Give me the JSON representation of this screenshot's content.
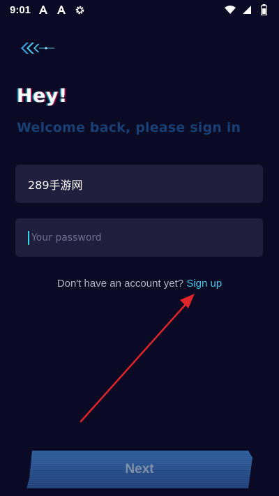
{
  "status_bar": {
    "time": "9:01",
    "icons": [
      "font-a-icon",
      "font-a-icon",
      "settings-gear-icon",
      "wifi-icon",
      "signal-icon",
      "battery-icon"
    ]
  },
  "header": {
    "back_icon": "double-chevron-left-icon",
    "greeting": "Hey!",
    "subtitle": "Welcome back, please sign in"
  },
  "form": {
    "username_value": "289手游网",
    "password_placeholder": "Your password"
  },
  "signup": {
    "prompt": "Don't have an account yet?",
    "link": "Sign up"
  },
  "actions": {
    "next_label": "Next"
  },
  "colors": {
    "background": "#0a0a24",
    "field_bg": "#1f1f3d",
    "accent": "#4fc3e8",
    "subtitle": "#1a3f74",
    "annotation": "#e0252a"
  }
}
